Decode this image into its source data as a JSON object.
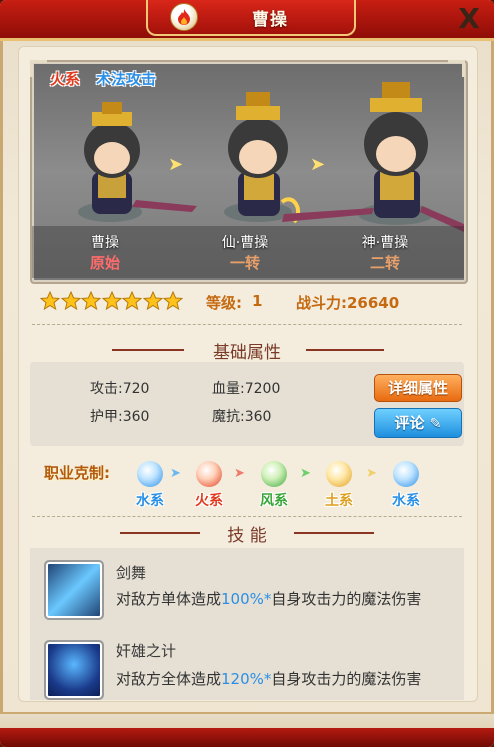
{
  "window": {
    "title": "曹操",
    "close_label": "X"
  },
  "hero": {
    "element_tag": "火系",
    "attack_type_tag": "术法攻击",
    "stages": [
      {
        "name": "曹操",
        "stage": "原始",
        "stage_color": "#ff6b6b"
      },
      {
        "name": "仙·曹操",
        "stage": "一转",
        "stage_color": "#e8a06a"
      },
      {
        "name": "神·曹操",
        "stage": "二转",
        "stage_color": "#e8a06a"
      }
    ],
    "stars": 7,
    "level_label": "等级:",
    "level_value": "1",
    "power": "战斗力:26640"
  },
  "attributes": {
    "heading": "基础属性",
    "attack": "攻击:720",
    "hp": "血量:7200",
    "armor": "护甲:360",
    "magic_resist": "魔抗:360",
    "detail_button": "详细属性",
    "review_button": "评论"
  },
  "counter": {
    "label": "职业克制:",
    "chain": [
      {
        "icon": "water-icon",
        "label": "水系",
        "color": "#2a8fe6"
      },
      {
        "icon": "fire-icon",
        "label": "火系",
        "color": "#e23a1d"
      },
      {
        "icon": "wind-icon",
        "label": "风系",
        "color": "#3aa63a"
      },
      {
        "icon": "earth-icon",
        "label": "土系",
        "color": "#e0a020"
      },
      {
        "icon": "water-icon",
        "label": "水系",
        "color": "#2a8fe6"
      }
    ]
  },
  "skills": {
    "heading": "技 能",
    "items": [
      {
        "name": "剑舞",
        "desc_pre": "对敌方单体造成",
        "desc_hl": "100%*",
        "desc_post": "自身攻击力的魔法伤害"
      },
      {
        "name": "奸雄之计",
        "desc_pre": "对敌方全体造成",
        "desc_hl": "120%*",
        "desc_post": "自身攻击力的魔法伤害"
      }
    ]
  }
}
